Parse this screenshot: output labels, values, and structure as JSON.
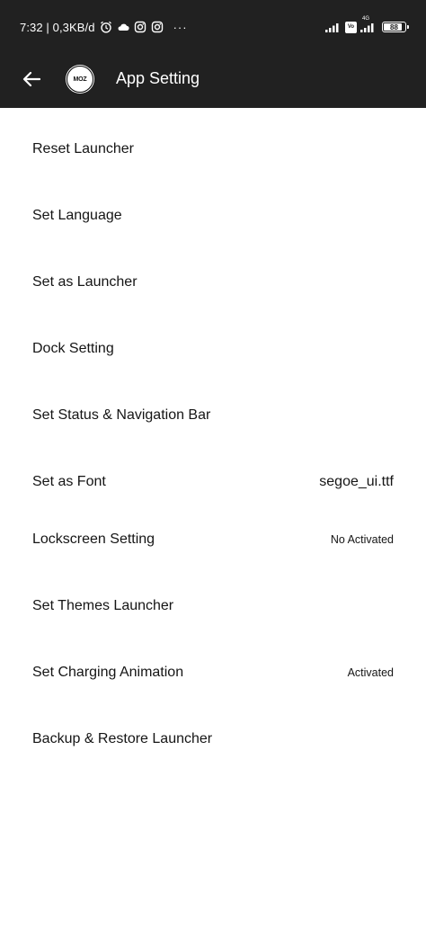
{
  "status_bar": {
    "time": "7:32",
    "network_speed": "0,3KB/d",
    "separator": "|",
    "more": "···",
    "net_badge": "Vo",
    "net_tag": "4G",
    "battery": "88",
    "battery_level_percent": 88,
    "left_icons": [
      "alarm-icon",
      "cloud-icon",
      "instagram-icon",
      "instagram-icon"
    ],
    "right_icons": [
      "signal-icon",
      "volte-icon",
      "signal-4g-icon",
      "battery-icon"
    ]
  },
  "app_bar": {
    "title": "App Setting",
    "logo_text": "MOZ",
    "back_icon": "arrow-left-icon",
    "background": "#212121",
    "text_color": "#ffffff"
  },
  "settings": [
    {
      "label": "Reset Launcher",
      "value": ""
    },
    {
      "label": "Set Language",
      "value": ""
    },
    {
      "label": "Set as Launcher",
      "value": ""
    },
    {
      "label": "Dock Setting",
      "value": ""
    },
    {
      "label": "Set Status & Navigation Bar",
      "value": ""
    },
    {
      "label": "Set as Font",
      "value": "segoe_ui.ttf"
    },
    {
      "label": "Lockscreen Setting",
      "value": "No Activated"
    },
    {
      "label": "Set Themes Launcher",
      "value": ""
    },
    {
      "label": "Set Charging Animation",
      "value": "Activated"
    },
    {
      "label": "Backup & Restore Launcher",
      "value": ""
    }
  ]
}
